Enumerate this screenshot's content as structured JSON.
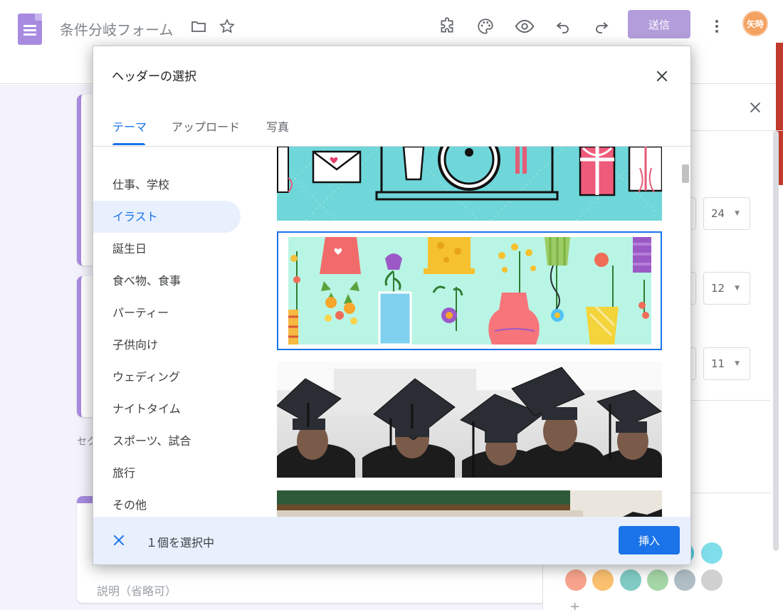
{
  "header": {
    "doc_title": "条件分岐フォーム",
    "send_label": "送信",
    "avatar_text": "矢時",
    "icons": [
      "folder-icon",
      "star-icon",
      "addon-icon",
      "palette-icon",
      "preview-eye-icon",
      "undo-icon",
      "redo-icon",
      "more-vert-icon"
    ]
  },
  "background": {
    "section_hint": "セク",
    "description_placeholder": "説明（省略可）",
    "font_sizes": [
      "24",
      "12",
      "11"
    ],
    "swatches": [
      "#4dd0e1",
      "#80deea",
      "#f8a48c",
      "#fbc16f",
      "#80cbc4",
      "#a5d6a7",
      "#b0bec5",
      "#d0d0d0"
    ]
  },
  "modal": {
    "title": "ヘッダーの選択",
    "tabs": [
      {
        "label": "テーマ",
        "active": true
      },
      {
        "label": "アップロード",
        "active": false
      },
      {
        "label": "写真",
        "active": false
      }
    ],
    "categories": [
      {
        "label": "仕事、学校",
        "active": false
      },
      {
        "label": "イラスト",
        "active": true
      },
      {
        "label": "誕生日",
        "active": false
      },
      {
        "label": "食べ物、食事",
        "active": false
      },
      {
        "label": "パーティー",
        "active": false
      },
      {
        "label": "子供向け",
        "active": false
      },
      {
        "label": "ウェディング",
        "active": false
      },
      {
        "label": "ナイトタイム",
        "active": false
      },
      {
        "label": "スポーツ、試合",
        "active": false
      },
      {
        "label": "旅行",
        "active": false
      },
      {
        "label": "その他",
        "active": false
      }
    ],
    "thumbnails": [
      "party-invitation-illustration",
      "flower-vases-illustration",
      "graduation-caps-photo",
      "classroom-chalkboard-photo"
    ],
    "selected_thumbnail": "flower-vases-illustration",
    "footer_text": "１個を選択中",
    "insert_label": "挿入"
  }
}
